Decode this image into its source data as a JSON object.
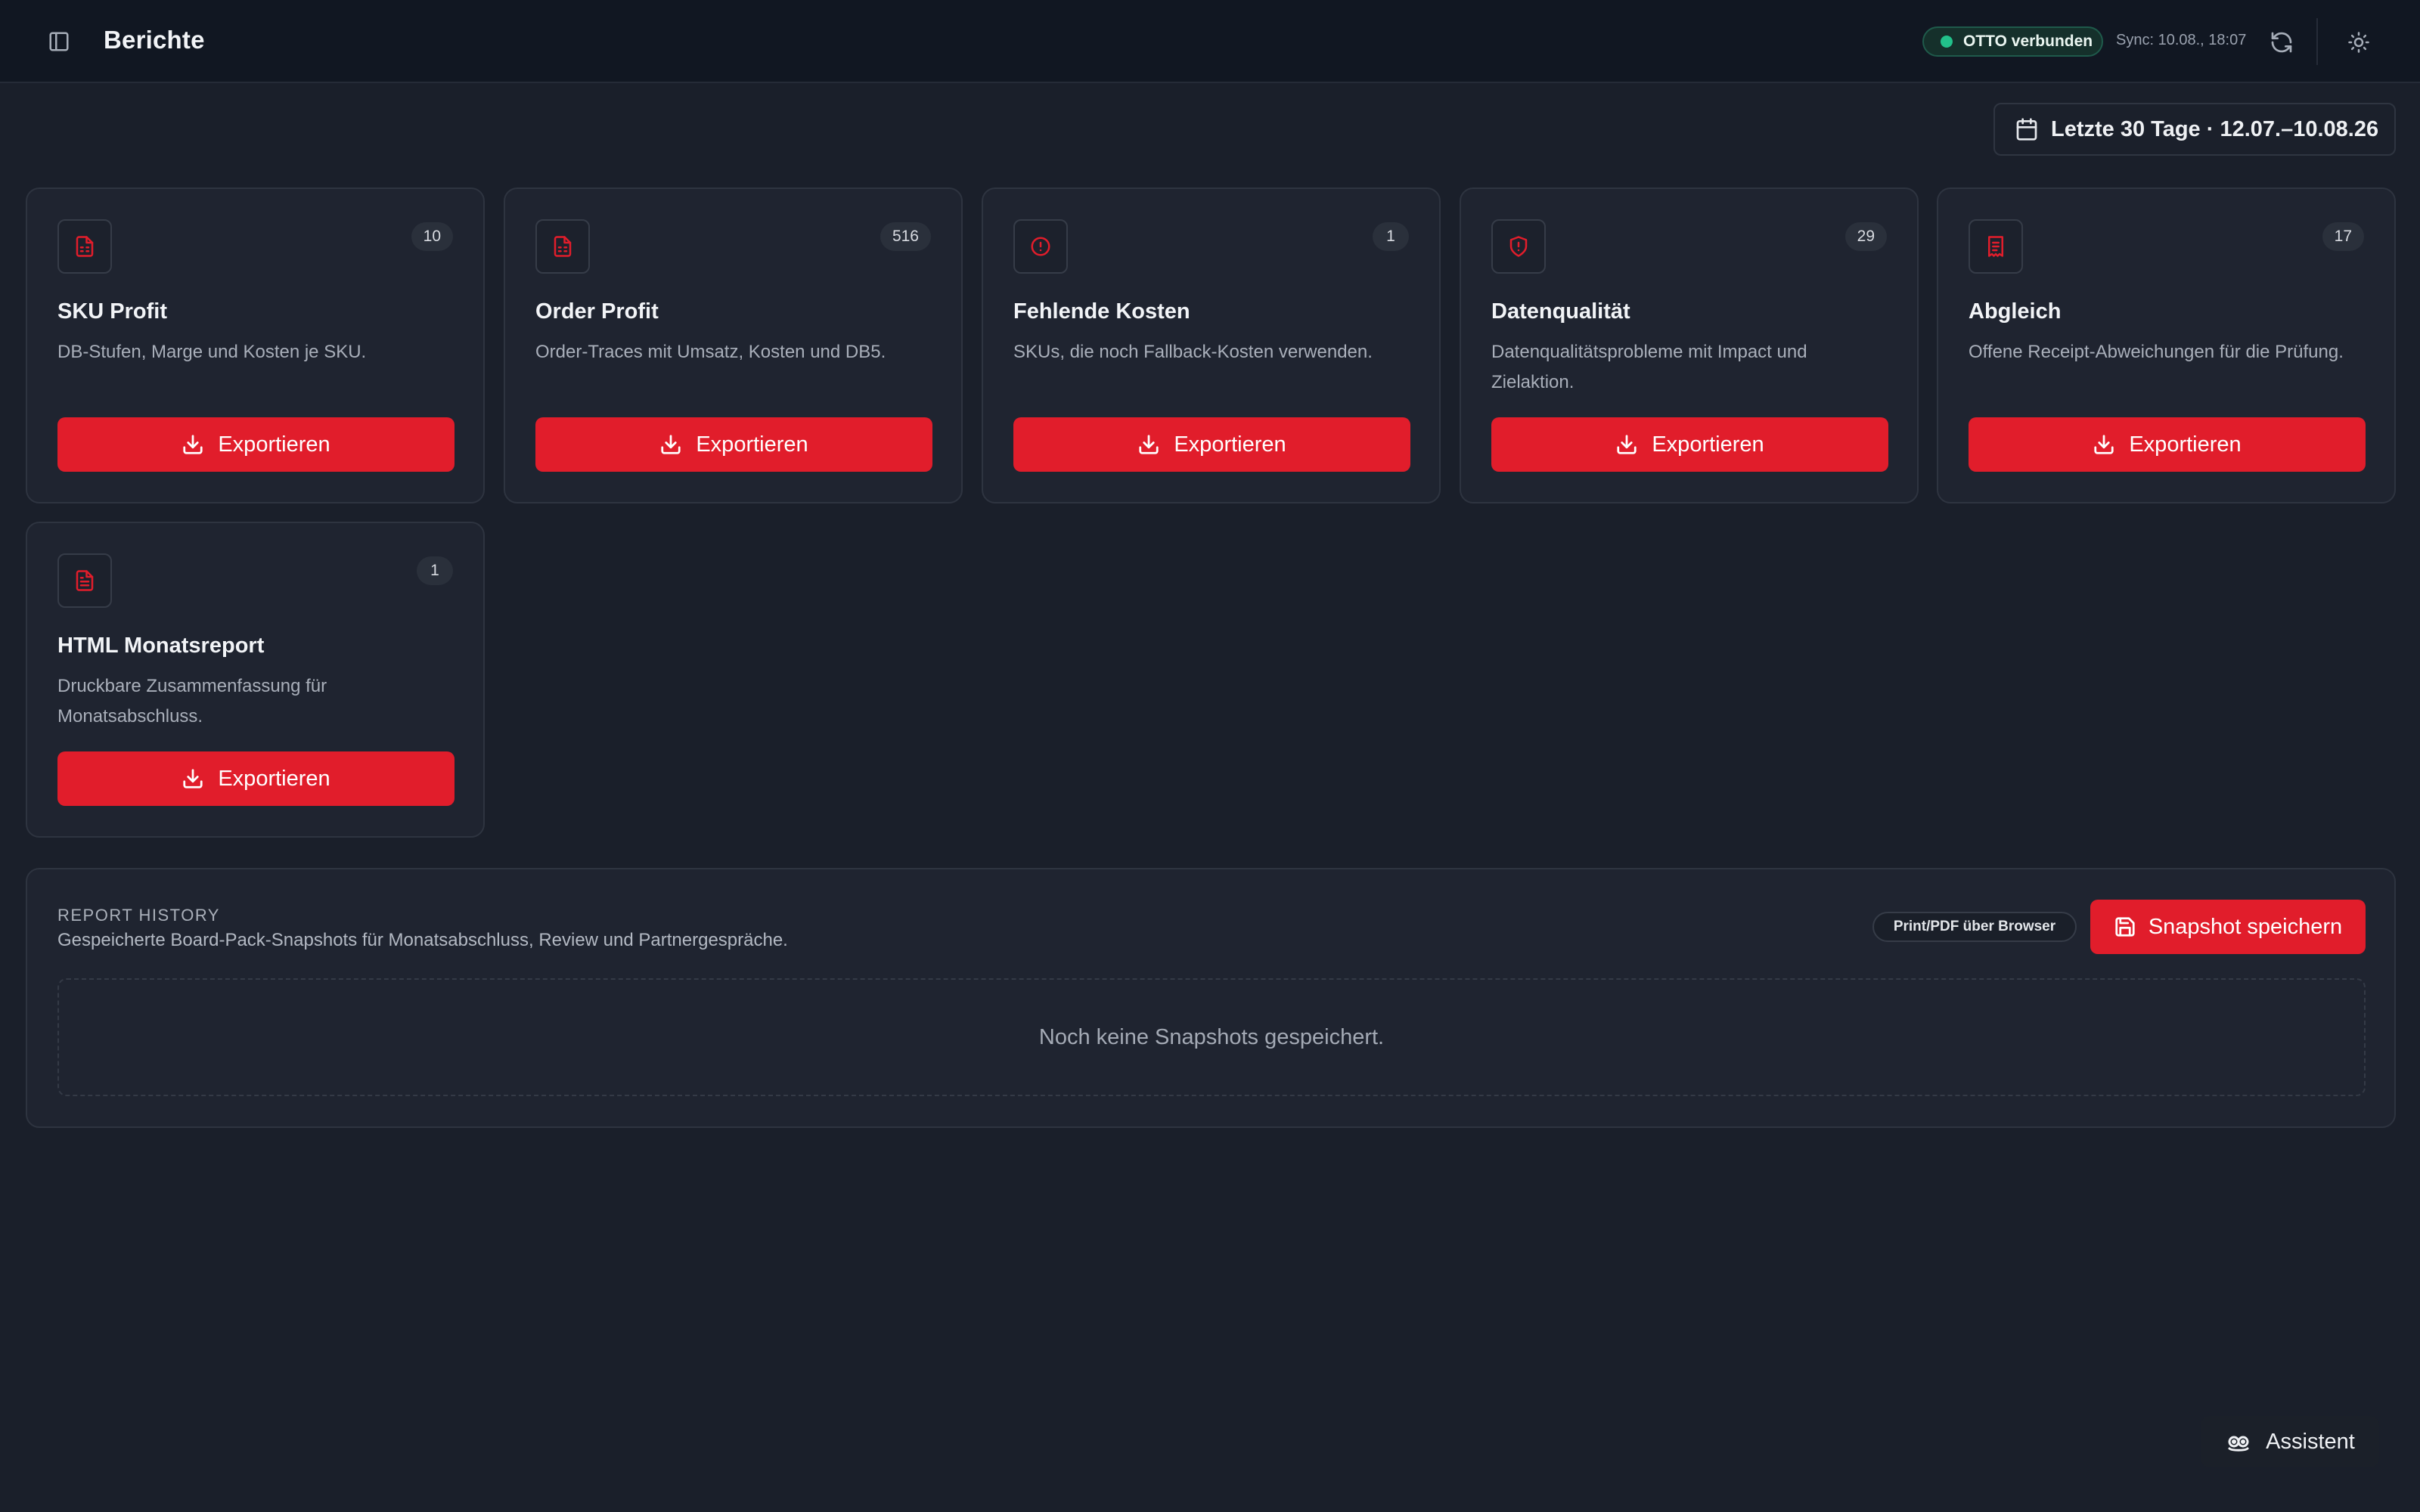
{
  "header": {
    "title": "Berichte",
    "status": "OTTO verbunden",
    "sync": "Sync: 10.08., 18:07"
  },
  "date_range": {
    "label": "Letzte 30 Tage · 12.07.–10.08.26"
  },
  "cards": [
    {
      "icon": "file-spreadsheet-icon",
      "count": "10",
      "title": "SKU Profit",
      "description": "DB-Stufen, Marge und Kosten je SKU.",
      "button": "Exportieren"
    },
    {
      "icon": "file-spreadsheet-icon",
      "count": "516",
      "title": "Order Profit",
      "description": "Order-Traces mit Umsatz, Kosten und DB5.",
      "button": "Exportieren"
    },
    {
      "icon": "alert-circle-icon",
      "count": "1",
      "title": "Fehlende Kosten",
      "description": "SKUs, die noch Fallback-Kosten verwenden.",
      "button": "Exportieren"
    },
    {
      "icon": "shield-alert-icon",
      "count": "29",
      "title": "Datenqualität",
      "description": "Datenqualitätsprobleme mit Impact und Zielaktion.",
      "button": "Exportieren"
    },
    {
      "icon": "receipt-icon",
      "count": "17",
      "title": "Abgleich",
      "description": "Offene Receipt-Abweichungen für die Prüfung.",
      "button": "Exportieren"
    },
    {
      "icon": "file-text-icon",
      "count": "1",
      "title": "HTML Monatsreport",
      "description": "Druckbare Zusammenfassung für Monatsabschluss.",
      "button": "Exportieren"
    }
  ],
  "history": {
    "label": "REPORT HISTORY",
    "description": "Gespeicherte Board-Pack-Snapshots für Monatsabschluss, Review und Partnergespräche.",
    "print_label": "Print/PDF über Browser",
    "snapshot_button": "Snapshot speichern",
    "empty": "Noch keine Snapshots gespeichert."
  },
  "assistant": {
    "label": "Assistent"
  },
  "colors": {
    "accent": "#e11d2b",
    "background": "#1a1f2a",
    "status": "#22c08a"
  }
}
